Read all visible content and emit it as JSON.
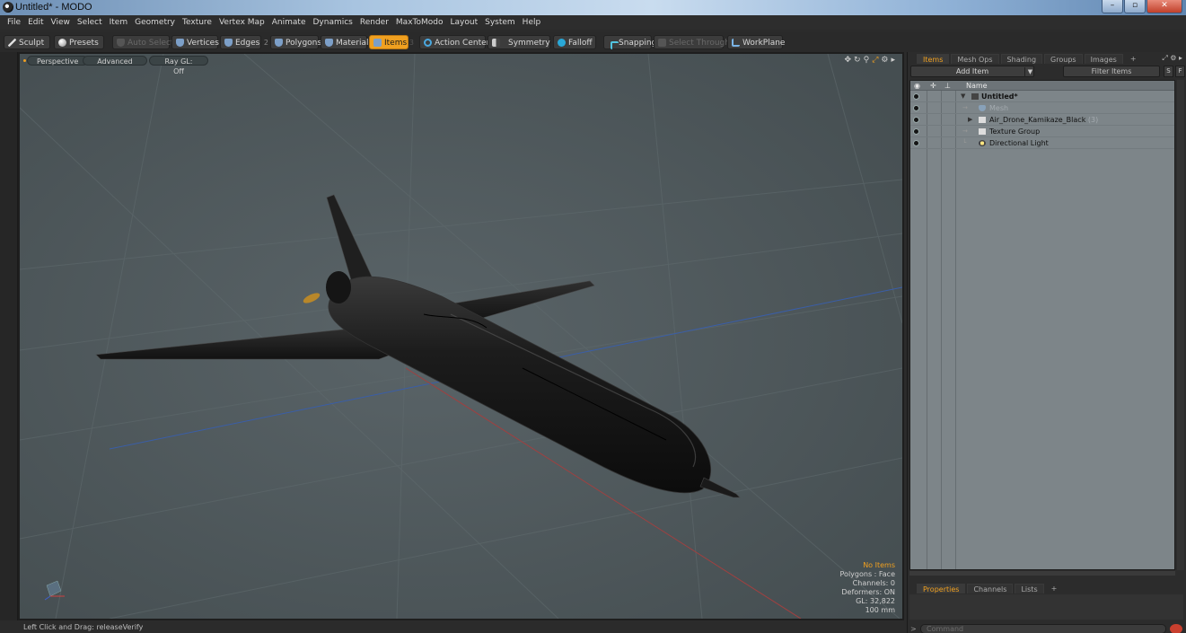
{
  "window": {
    "title": "Untitled* - MODO",
    "minimize": "–",
    "maximize": "▫",
    "close": "✕"
  },
  "menu": [
    "File",
    "Edit",
    "View",
    "Select",
    "Item",
    "Geometry",
    "Texture",
    "Vertex Map",
    "Animate",
    "Dynamics",
    "Render",
    "MaxToModo",
    "Layout",
    "System",
    "Help"
  ],
  "toolbar": {
    "sculpt": "Sculpt",
    "presets": "Presets",
    "auto_select": "Auto Select",
    "vertices": "Vertices",
    "edges": "Edges",
    "edges_count": "2",
    "polygons": "Polygons",
    "materials": "Materials",
    "items": "Items",
    "items_count": "3",
    "action_center": "Action Center",
    "symmetry": "Symmetry",
    "falloff": "Falloff",
    "snapping": "Snapping",
    "select_through": "Select Through",
    "workplane": "WorkPlane"
  },
  "viewport": {
    "view_mode": "Perspective",
    "style": "Advanced",
    "raygl": "Ray GL: Off",
    "tool_icons": [
      "✥",
      "↻",
      "⚲",
      "⤢",
      "⚙",
      "▸"
    ],
    "stats": {
      "items": "No Items",
      "polygons": "Polygons : Face",
      "channels": "Channels: 0",
      "deformers": "Deformers: ON",
      "gl": "GL: 32,822",
      "unit": "100 mm"
    },
    "colors": {
      "background": "#4b5558",
      "highlight": "#f0a020"
    }
  },
  "status": {
    "hint": "Left Click and Drag:  releaseVerify"
  },
  "right_panel": {
    "tabs": [
      "Items",
      "Mesh Ops",
      "Shading",
      "Groups",
      "Images",
      "+"
    ],
    "add_item": "Add Item",
    "filter_placeholder": "Filter Items",
    "btn_s": "S",
    "btn_f": "F",
    "name_header": "Name",
    "tree": [
      {
        "label": "Untitled*",
        "bold": true
      },
      {
        "label": "Mesh",
        "dim": true
      },
      {
        "label": "Air_Drone_Kamikaze_Black",
        "count": "(3)"
      },
      {
        "label": "Texture Group"
      },
      {
        "label": "Directional Light"
      }
    ],
    "props_tabs": [
      "Properties",
      "Channels",
      "Lists",
      "+"
    ],
    "command_placeholder": "Command",
    "command_prompt": ">"
  }
}
